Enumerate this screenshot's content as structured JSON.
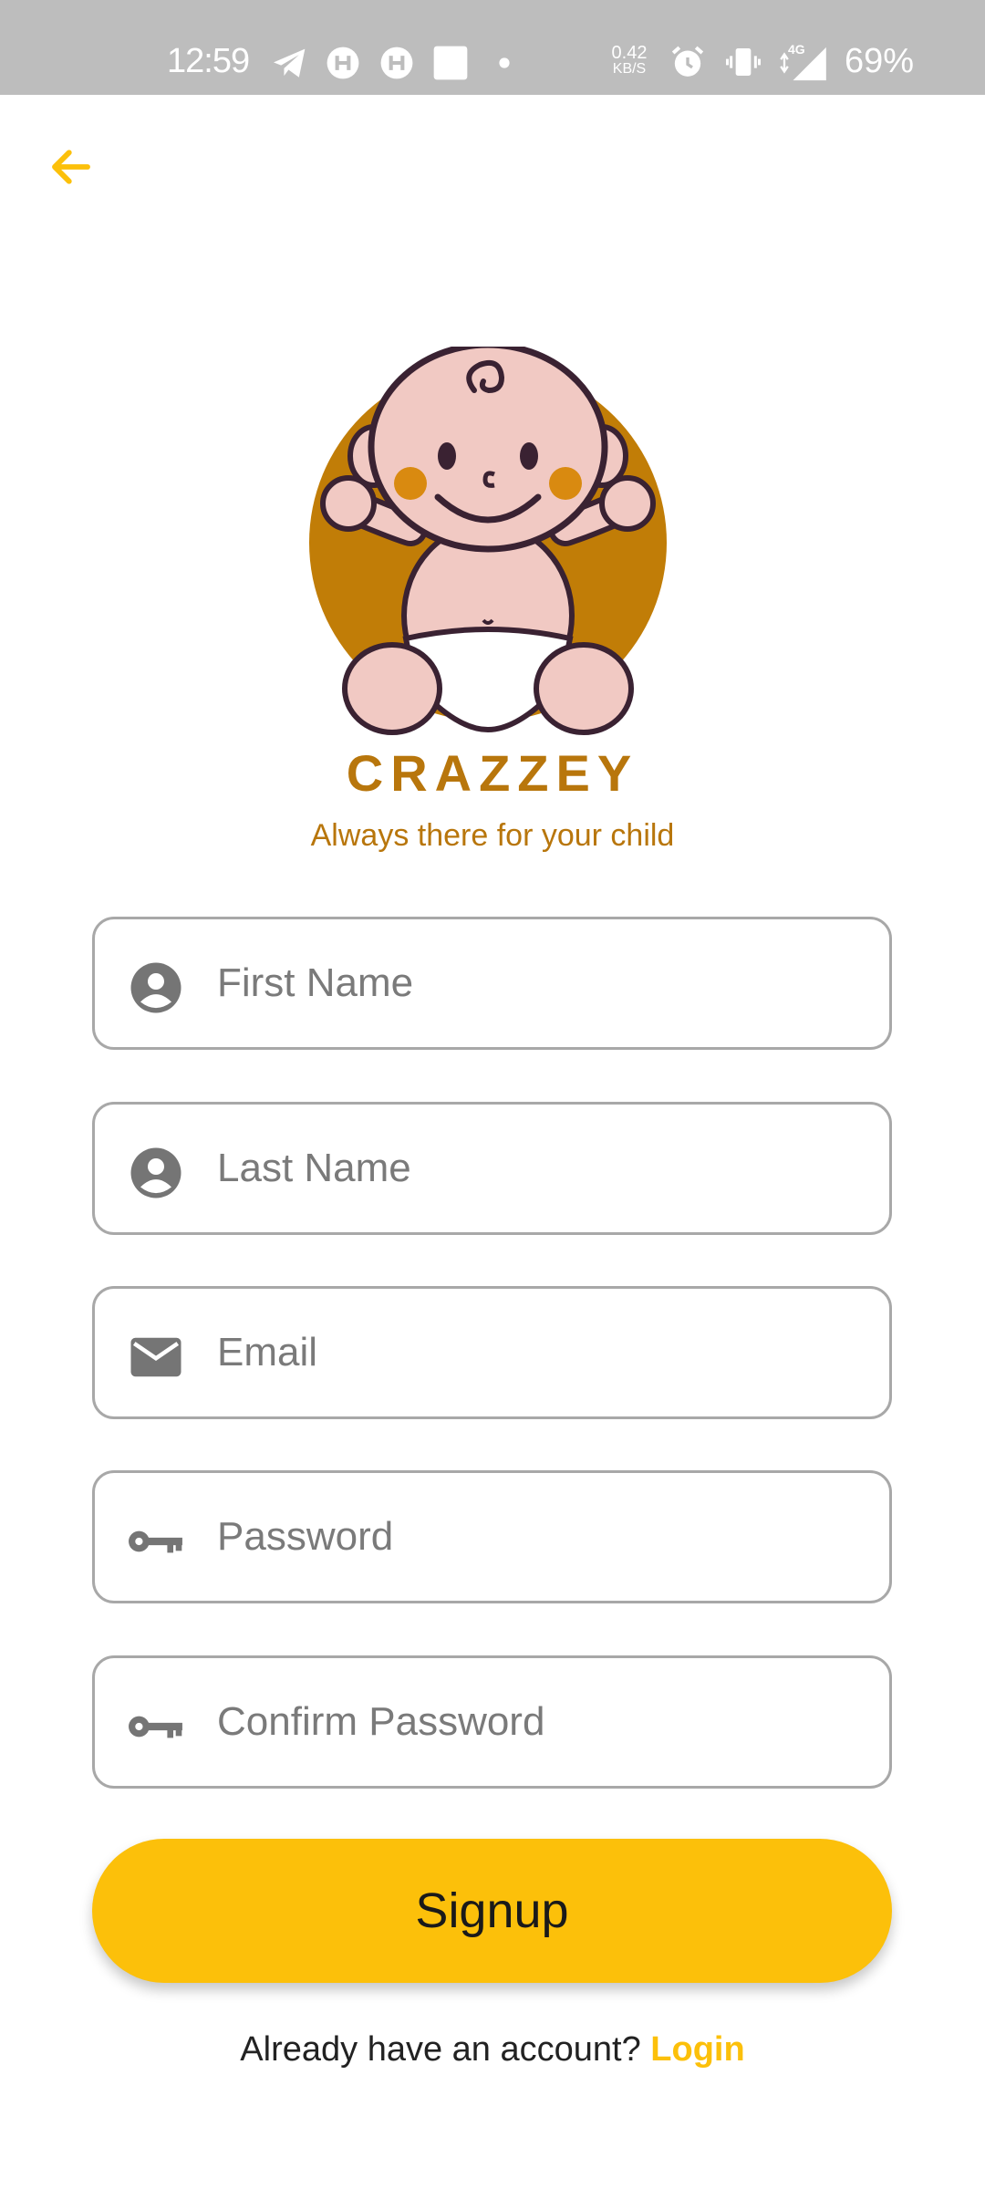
{
  "status_bar": {
    "time": "12:59",
    "net_speed_value": "0.42",
    "net_speed_unit": "KB/S",
    "network_type": "4G",
    "battery": "69%"
  },
  "colors": {
    "accent": "#fcc00a",
    "brand": "#b8760c",
    "status_bar_bg": "#bdbdbd",
    "field_border": "#a8a8a8",
    "icon_gray": "#757575"
  },
  "header": {
    "back_icon": "arrow-left-icon"
  },
  "brand": {
    "name": "CRAZZEY",
    "tagline": "Always there for your child"
  },
  "form": {
    "fields": [
      {
        "icon": "account-circle-icon",
        "placeholder": "First Name",
        "value": ""
      },
      {
        "icon": "account-circle-icon",
        "placeholder": "Last Name",
        "value": ""
      },
      {
        "icon": "mail-icon",
        "placeholder": "Email",
        "value": ""
      },
      {
        "icon": "key-icon",
        "placeholder": "Password",
        "value": ""
      },
      {
        "icon": "key-icon",
        "placeholder": "Confirm Password",
        "value": ""
      }
    ],
    "submit_label": "Signup"
  },
  "footer": {
    "prompt": "Already have an account? ",
    "link_label": "Login"
  }
}
